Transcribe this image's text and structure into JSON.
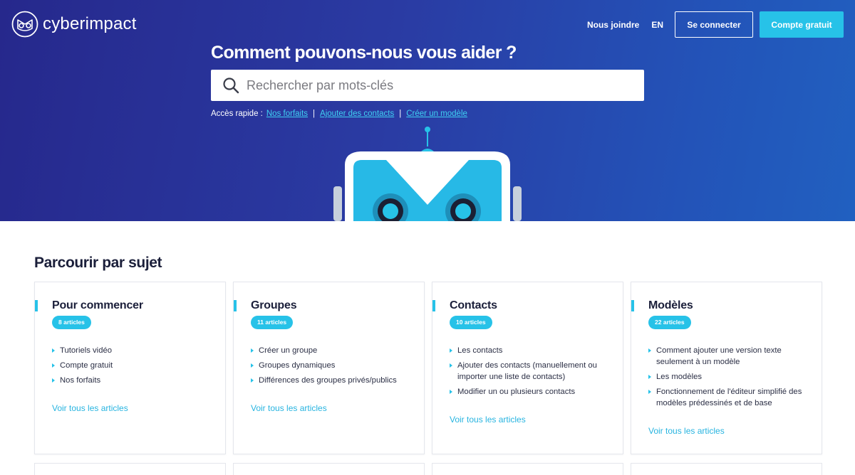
{
  "header": {
    "logo_text": "cyberimpact",
    "logo_icon": "owl-robot-logo-icon",
    "nav": {
      "contact_label": "Nous joindre",
      "lang_label": "EN",
      "login_label": "Se connecter",
      "signup_label": "Compte gratuit"
    }
  },
  "hero": {
    "title": "Comment pouvons-nous vous aider ?",
    "search": {
      "placeholder": "Rechercher par mots-clés",
      "value": "",
      "icon": "search-icon"
    },
    "quick_access": {
      "label": "Accès rapide :",
      "links": [
        "Nos forfaits",
        "Ajouter des contacts",
        "Créer un modèle"
      ],
      "separator": "|"
    }
  },
  "topics": {
    "title": "Parcourir par sujet",
    "cards": [
      {
        "title": "Pour commencer",
        "badge": "8 articles",
        "items": [
          "Tutoriels vidéo",
          "Compte gratuit",
          "Nos forfaits"
        ],
        "more": "Voir tous les articles"
      },
      {
        "title": "Groupes",
        "badge": "11 articles",
        "items": [
          "Créer un groupe",
          "Groupes dynamiques",
          "Différences des groupes privés/publics"
        ],
        "more": "Voir tous les articles"
      },
      {
        "title": "Contacts",
        "badge": "10 articles",
        "items": [
          "Les contacts",
          "Ajouter des contacts (manuellement ou importer une liste de contacts)",
          "Modifier un ou plusieurs contacts"
        ],
        "more": "Voir tous les articles"
      },
      {
        "title": "Modèles",
        "badge": "22 articles",
        "items": [
          "Comment ajouter une version texte seulement à un modèle",
          "Les modèles",
          "Fonctionnement de l'éditeur simplifié des modèles prédessinés et de base"
        ],
        "more": "Voir tous les articles"
      }
    ]
  },
  "colors": {
    "hero_gradient_start": "#26288c",
    "hero_gradient_end": "#2160c0",
    "accent": "#27c2e8",
    "text_dark": "#1b1f3a"
  }
}
